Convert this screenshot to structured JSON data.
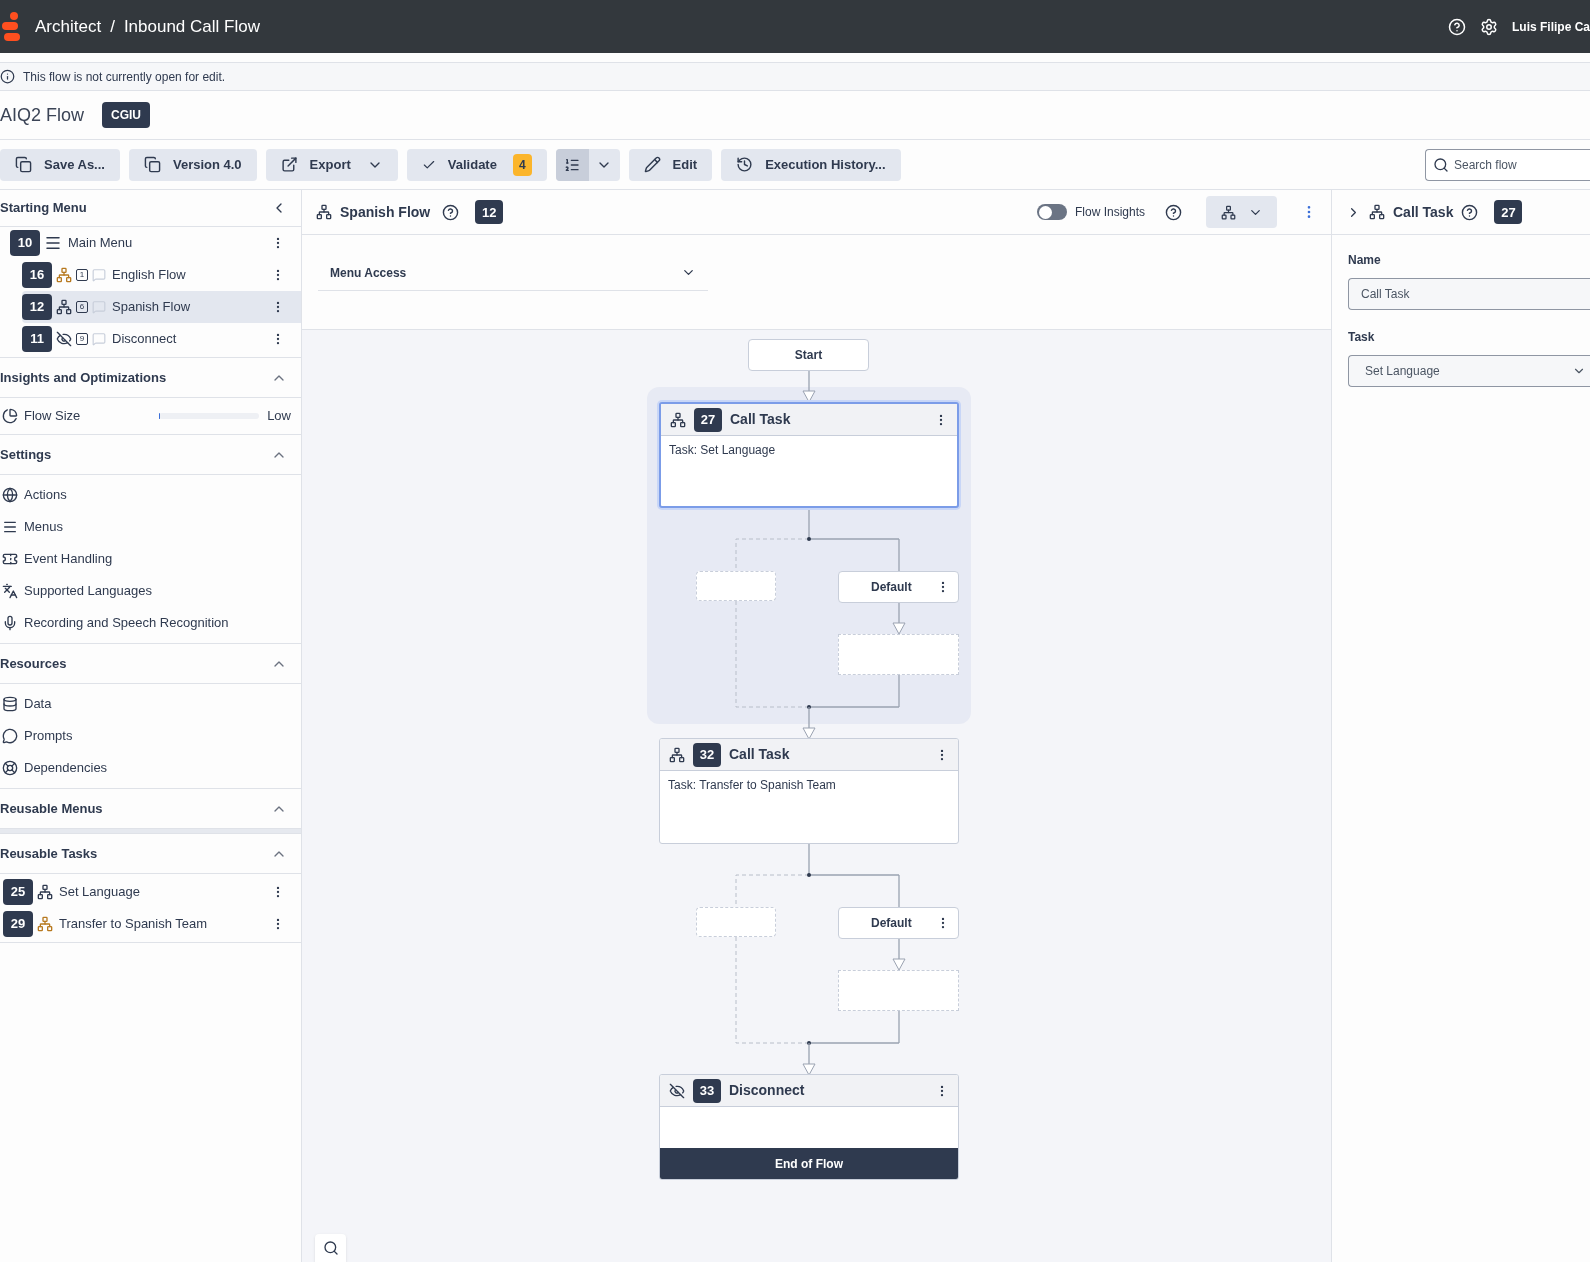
{
  "header": {
    "breadcrumb": [
      "Architect",
      "Inbound Call Flow"
    ],
    "separator": "/",
    "user": "Luis Filipe Ca"
  },
  "notice": "This flow is not currently open for edit.",
  "flow": {
    "name": "AIQ2 Flow",
    "badge": "CGIU"
  },
  "toolbar": [
    {
      "kind": "copy",
      "label": "Save As..."
    },
    {
      "kind": "copy",
      "label": "Version 4.0"
    },
    {
      "kind": "export",
      "label": "Export"
    },
    {
      "kind": "validate",
      "label": "Validate",
      "count": "4"
    },
    {
      "kind": "outline",
      "selected": true
    },
    {
      "kind": "edit",
      "label": "Edit"
    },
    {
      "kind": "history",
      "label": "Execution History..."
    }
  ],
  "search": {
    "placeholder": "Search flow"
  },
  "sidebar": {
    "starting_menu": {
      "title": "Starting Menu",
      "items": [
        {
          "kind": "menu",
          "number": "10",
          "label": "Main Menu",
          "selected": false,
          "children": [
            {
              "kind": "task",
              "number": "16",
              "count": "1",
              "label": "English Flow",
              "color": "#b7791f",
              "selected": false
            },
            {
              "kind": "task",
              "number": "12",
              "count": "6",
              "label": "Spanish Flow",
              "color": "#2f3a4f",
              "selected": true
            },
            {
              "kind": "disconnect",
              "number": "11",
              "count": "9",
              "label": "Disconnect",
              "color": "#2f3a4f",
              "selected": false
            }
          ]
        }
      ]
    },
    "sections": [
      {
        "kind": "insights",
        "title": "Insights and Optimizations",
        "expanded": true,
        "items": [
          {
            "kind": "pie",
            "label": "Flow Size",
            "level": 0.01,
            "reading": "Low"
          }
        ]
      },
      {
        "kind": "links",
        "title": "Settings",
        "expanded": true,
        "items": [
          {
            "kind": "globe",
            "label": "Actions"
          },
          {
            "kind": "menu",
            "label": "Menus"
          },
          {
            "kind": "ticket",
            "label": "Event Handling"
          },
          {
            "kind": "languages",
            "label": "Supported Languages"
          },
          {
            "kind": "mic",
            "label": "Recording and Speech Recognition"
          }
        ]
      },
      {
        "kind": "links",
        "title": "Resources",
        "expanded": true,
        "items": [
          {
            "kind": "database",
            "label": "Data"
          },
          {
            "kind": "message",
            "label": "Prompts"
          },
          {
            "kind": "lifebuoy",
            "label": "Dependencies"
          }
        ]
      },
      {
        "kind": "menus",
        "title": "Reusable Menus",
        "expanded": true
      },
      {
        "kind": "tasks",
        "title": "Reusable Tasks",
        "expanded": true,
        "items": [
          {
            "number": "25",
            "label": "Set Language",
            "color": "#2f3a4f"
          },
          {
            "number": "29",
            "label": "Transfer to Spanish Team",
            "color": "#b7791f"
          }
        ]
      }
    ]
  },
  "editor": {
    "title": "Spanish Flow",
    "badge": "12",
    "insights_toggle": {
      "label": "Flow Insights",
      "on": false
    },
    "menu_access": {
      "label": "Menu Access",
      "expanded": false
    }
  },
  "canvas": {
    "start": "Start",
    "nodes": [
      {
        "kind": "task",
        "number": "27",
        "title": "Call Task",
        "body": "Task: Set Language",
        "branch": "Default",
        "selected": true
      },
      {
        "kind": "task",
        "number": "32",
        "title": "Call Task",
        "body": "Task: Transfer to Spanish Team",
        "branch": "Default",
        "selected": false
      },
      {
        "kind": "disconnect",
        "number": "33",
        "title": "Disconnect",
        "footer": "End of Flow",
        "selected": false
      }
    ]
  },
  "properties": {
    "title": "Call Task",
    "badge": "27",
    "fields": [
      {
        "kind": "text",
        "label": "Name",
        "value": "Call Task"
      },
      {
        "kind": "select",
        "label": "Task",
        "value": "Set Language"
      }
    ]
  }
}
